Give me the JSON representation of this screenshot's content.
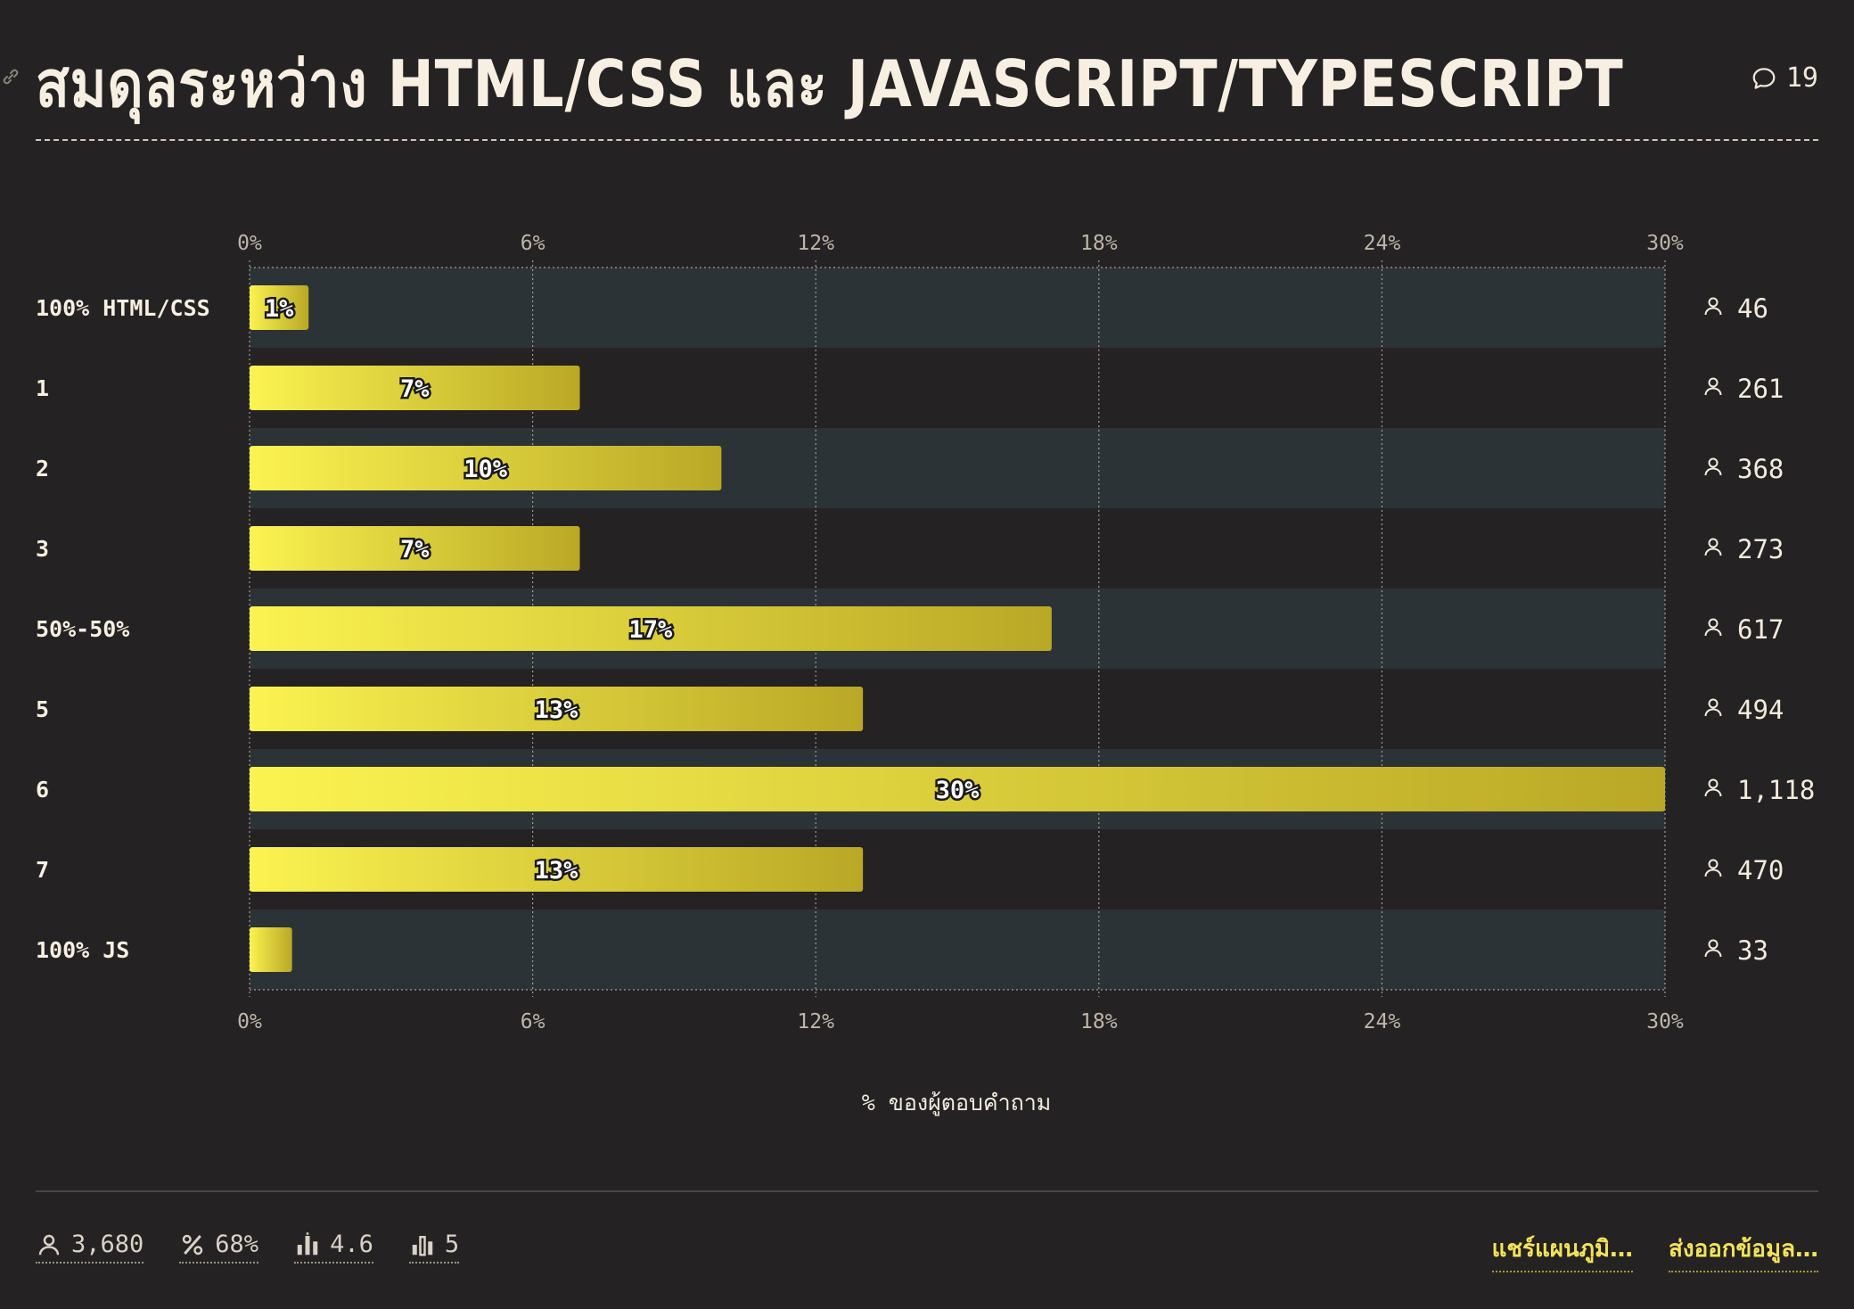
{
  "header": {
    "title": "สมดุลระหว่าง HTML/CSS และ JAVASCRIPT/TYPESCRIPT",
    "comment_count": "19"
  },
  "chart_data": {
    "type": "bar",
    "orientation": "horizontal",
    "categories": [
      "100% HTML/CSS",
      "1",
      "2",
      "3",
      "50%-50%",
      "5",
      "6",
      "7",
      "100% JS"
    ],
    "values": [
      1.25,
      7,
      10,
      7,
      17,
      13,
      30,
      13,
      0.9
    ],
    "value_labels": [
      "1%",
      "7%",
      "10%",
      "7%",
      "17%",
      "13%",
      "30%",
      "13%",
      ""
    ],
    "counts": [
      "46",
      "261",
      "368",
      "273",
      "617",
      "494",
      "1,118",
      "470",
      "33"
    ],
    "xlim": [
      0,
      30
    ],
    "xticks": [
      0,
      6,
      12,
      18,
      24,
      30
    ],
    "tick_labels": [
      "0%",
      "6%",
      "12%",
      "18%",
      "24%",
      "30%"
    ],
    "xlabel": "% ของผู้ตอบคำถาม",
    "grid": true,
    "colors": {
      "bar_start": "#fbf351",
      "bar_end": "#b9a826",
      "row_band": "#2c3336",
      "background": "#252223"
    }
  },
  "footer": {
    "stats": [
      {
        "icon": "user-icon",
        "value": "3,680"
      },
      {
        "icon": "percent-icon",
        "value": "68%"
      },
      {
        "icon": "bar-chart-icon",
        "value": "4.6"
      },
      {
        "icon": "median-chart-icon",
        "value": "5"
      }
    ],
    "actions": [
      "แชร์แผนภูมิ…",
      "ส่งออกข้อมูล…"
    ]
  }
}
